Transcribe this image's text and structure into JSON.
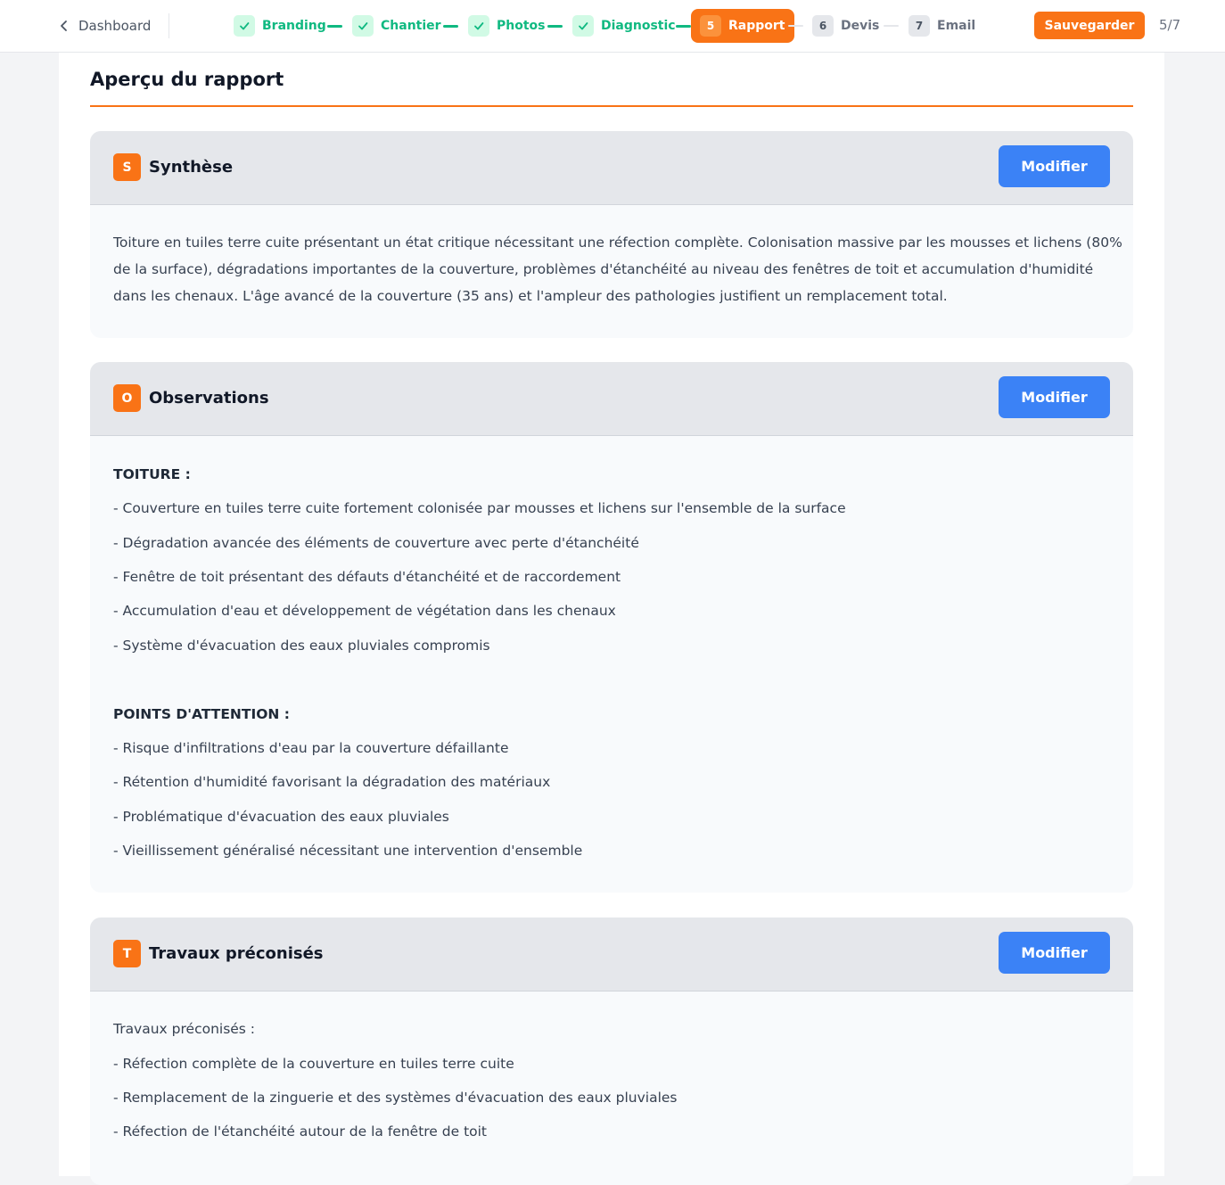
{
  "topbar": {
    "back_label": "Dashboard",
    "steps": [
      {
        "label": "Branding",
        "state": "done"
      },
      {
        "label": "Chantier",
        "state": "done"
      },
      {
        "label": "Photos",
        "state": "done"
      },
      {
        "label": "Diagnostic",
        "state": "done"
      },
      {
        "number": "5",
        "label": "Rapport",
        "state": "active"
      },
      {
        "number": "6",
        "label": "Devis",
        "state": "todo"
      },
      {
        "number": "7",
        "label": "Email",
        "state": "todo"
      }
    ],
    "save_label": "Sauvegarder",
    "counter": "5/7"
  },
  "colors": {
    "accent": "#f97316",
    "done": "#10b981",
    "button": "#3b82f6"
  },
  "main": {
    "title": "Aperçu du rapport",
    "sections": [
      {
        "badge": "S",
        "title": "Synthèse",
        "button": "Modifier",
        "paragraph_lines": [
          "Toiture en tuiles terre cuite présentant un état critique nécessitant une réfection complète. Colonisation massive par les mousses et lichens (80%",
          "de la surface), dégradations importantes de la couverture, problèmes d'étanchéité au niveau des fenêtres de toit et accumulation d'humidité",
          "dans les chenaux. L'âge avancé de la couverture (35 ans) et l'ampleur des pathologies justifient un remplacement total."
        ]
      },
      {
        "badge": "O",
        "title": "Observations",
        "button": "Modifier",
        "lines": [
          "TOITURE :",
          "- Couverture en tuiles terre cuite fortement colonisée par mousses et lichens sur l'ensemble de la surface",
          "- Dégradation avancée des éléments de couverture avec perte d'étanchéité",
          "- Fenêtre de toit présentant des défauts d'étanchéité et de raccordement",
          "- Accumulation d'eau et développement de végétation dans les chenaux",
          "- Système d'évacuation des eaux pluviales compromis",
          "POINTS D'ATTENTION :",
          "- Risque d'infiltrations d'eau par la couverture défaillante",
          "- Rétention d'humidité favorisant la dégradation des matériaux",
          "- Problématique d'évacuation des eaux pluviales",
          "- Vieillissement généralisé nécessitant une intervention d'ensemble"
        ]
      },
      {
        "badge": "T",
        "title": "Travaux préconisés",
        "button": "Modifier",
        "lines": [
          "Travaux préconisés :",
          "- Réfection complète de la couverture en tuiles terre cuite",
          "- Remplacement de la zinguerie et des systèmes d'évacuation des eaux pluviales",
          "- Réfection de l'étanchéité autour de la fenêtre de toit"
        ]
      }
    ]
  }
}
